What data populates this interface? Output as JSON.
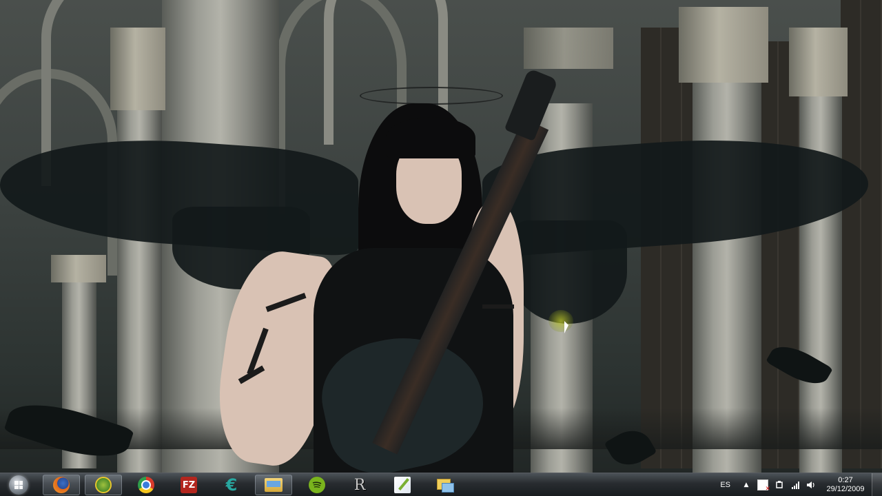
{
  "taskbar": {
    "start_button": "Start",
    "apps": [
      {
        "name": "Firefox",
        "icon": "firefox-icon"
      },
      {
        "name": "QGIS",
        "icon": "qgis-icon"
      },
      {
        "name": "Google Chrome",
        "icon": "chrome-icon"
      },
      {
        "name": "FileZilla",
        "icon": "filezilla-icon",
        "glyph": "FZ"
      },
      {
        "name": "Euro app",
        "icon": "euro-icon",
        "glyph": "€"
      },
      {
        "name": "Windows Explorer",
        "icon": "explorer-icon"
      },
      {
        "name": "Spotify",
        "icon": "spotify-icon"
      },
      {
        "name": "R",
        "icon": "r-icon",
        "glyph": "R"
      },
      {
        "name": "Notepad",
        "icon": "notepad-icon"
      },
      {
        "name": "Folders",
        "icon": "folders-icon"
      }
    ]
  },
  "tray": {
    "language": "ES",
    "show_hidden": "▲",
    "clock_time": "0:27",
    "clock_date": "29/12/2009"
  },
  "colors": {
    "taskbar_bg": "#2a2e33",
    "wallpaper_shadow": "#12191a"
  }
}
